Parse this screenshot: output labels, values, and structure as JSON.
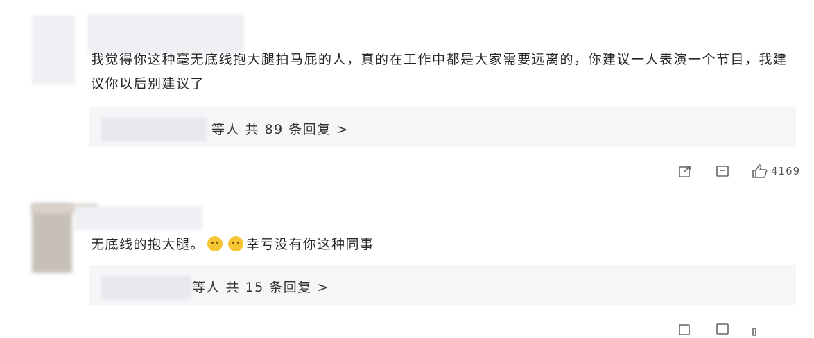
{
  "comment1": {
    "text": "我觉得你这种毫无底线抱大腿拍马屁的人，真的在工作中都是大家需要远离的，你建议一人表演一个节目，我建议你以后别建议了",
    "reply_summary": "等人 共 89 条回复 >",
    "like_count": "4169",
    "icons": [
      "share-icon",
      "comment-icon",
      "like-icon"
    ]
  },
  "comment2": {
    "text_before": "无底线的抱大腿。",
    "emoji": [
      "grin-emoji",
      "grin-emoji"
    ],
    "text_after": "幸亏没有你这种同事",
    "reply_summary": "等人 共 15 条回复 >",
    "icons": [
      "share-icon",
      "comment-icon",
      "like-icon"
    ]
  }
}
